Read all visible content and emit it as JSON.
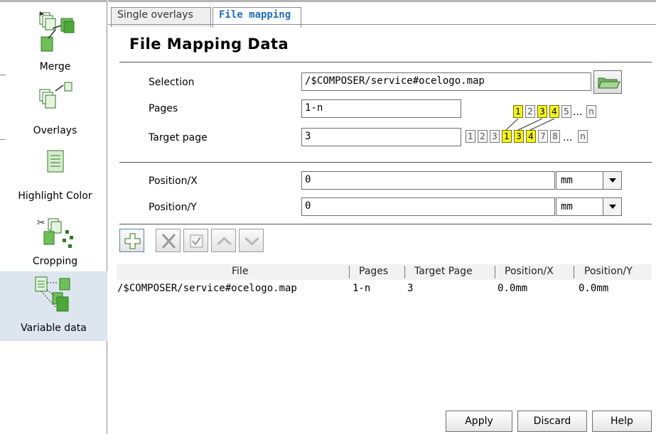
{
  "sidebar": {
    "items": [
      {
        "label": "Merge",
        "icon": "merge-icon"
      },
      {
        "label": "Overlays",
        "icon": "overlays-icon"
      },
      {
        "label": "Highlight Color",
        "icon": "highlight-color-icon"
      },
      {
        "label": "Cropping",
        "icon": "cropping-icon"
      },
      {
        "label": "Variable data",
        "icon": "variable-data-icon"
      }
    ],
    "selected": "Variable data"
  },
  "tabs": [
    {
      "label": "Single overlays",
      "active": false
    },
    {
      "label": "File mapping",
      "active": true
    }
  ],
  "panel": {
    "title": "File Mapping Data",
    "selection_label": "Selection",
    "selection_value": "/$COMPOSER/service#ocelogo.map",
    "pages_label": "Pages",
    "pages_value": "1-n",
    "target_label": "Target page",
    "target_value": "3",
    "posx_label": "Position/X",
    "posx_value": "0",
    "posx_unit": "mm",
    "posy_label": "Position/Y",
    "posy_value": "0",
    "posy_unit": "mm"
  },
  "page_diagram": {
    "source_pages": [
      "1",
      "2",
      "3",
      "4",
      "5",
      "n"
    ],
    "target_pages": [
      "1",
      "2",
      "3",
      "1",
      "3",
      "4",
      "7",
      "8",
      "n"
    ],
    "ellipsis": "..."
  },
  "toolbar": {
    "icons": [
      "add-icon",
      "delete-icon",
      "confirm-icon",
      "move-up-icon",
      "move-down-icon"
    ]
  },
  "table": {
    "columns": [
      "File",
      "Pages",
      "Target Page",
      "Position/X",
      "Position/Y"
    ],
    "rows": [
      {
        "file": "/$COMPOSER/service#ocelogo.map",
        "pages": "1-n",
        "target": "3",
        "x": "0.0mm",
        "y": "0.0mm"
      }
    ]
  },
  "buttons": {
    "apply": "Apply",
    "discard": "Discard",
    "help": "Help"
  },
  "colors": {
    "selection": "#dde6ef",
    "active_tab_text": "#1a6fbf",
    "highlight_page": "#f6f21c",
    "icon_green": "#3a9a2a"
  }
}
